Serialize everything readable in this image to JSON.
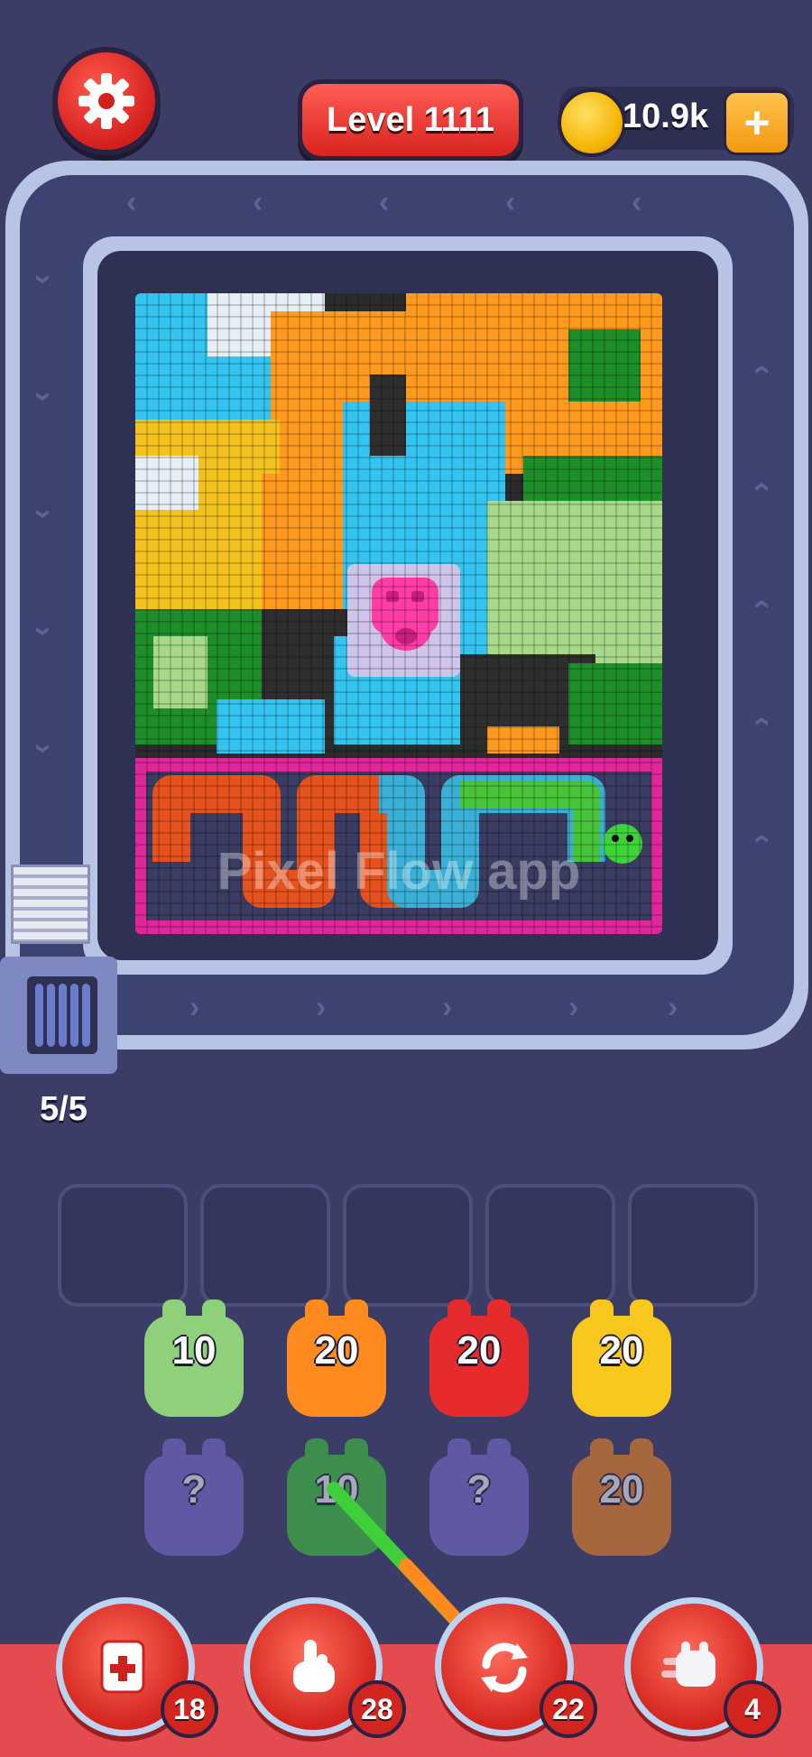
{
  "header": {
    "level_label": "Level 1111",
    "coins": "10.9k",
    "coin_add": "+"
  },
  "conveyor": {
    "capacity_label": "5/5"
  },
  "board": {
    "watermark": "Pixel Flow app"
  },
  "queue_slots": 5,
  "pieces": {
    "row1": [
      {
        "label": "10",
        "color": "#8fd07a"
      },
      {
        "label": "20",
        "color": "#ff8a1e"
      },
      {
        "label": "20",
        "color": "#e52b2b"
      },
      {
        "label": "20",
        "color": "#f9c81e"
      }
    ],
    "row2": [
      {
        "label": "?",
        "color": "#7d6fd6"
      },
      {
        "label": "10",
        "color": "#3fcf3a"
      },
      {
        "label": "?",
        "color": "#7d6fd6"
      },
      {
        "label": "20",
        "color": "#ff8a1e"
      }
    ]
  },
  "tools": [
    {
      "name": "add-slot",
      "count": "18"
    },
    {
      "name": "hand",
      "count": "28"
    },
    {
      "name": "shuffle",
      "count": "22"
    },
    {
      "name": "ghost-piece",
      "count": "4"
    }
  ],
  "colors": {
    "background": "#3b3d66",
    "accent_red": "#e34b4e",
    "coin_gold": "#f4b400"
  }
}
